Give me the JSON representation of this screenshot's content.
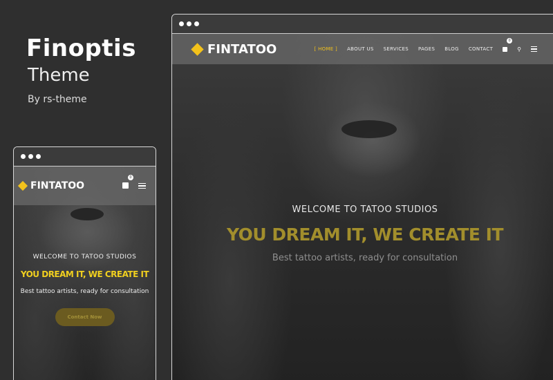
{
  "info": {
    "name": "Finoptis",
    "subtitle": "Theme",
    "author": "By rs-theme"
  },
  "brand": {
    "logo_text": "FINTATOO",
    "accent": "#f3c21b"
  },
  "desktop": {
    "nav": [
      "[ HOME ]",
      "ABOUT US",
      "SERVICES",
      "PAGES",
      "BLOG",
      "CONTACT"
    ],
    "cart_count": "0",
    "hero": {
      "welcome": "WELCOME TO TATOO STUDIOS",
      "headline": "YOU DREAM IT, WE CREATE IT",
      "tagline": "Best tattoo artists, ready for consultation"
    }
  },
  "mobile": {
    "cart_count": "0",
    "hero": {
      "welcome": "WELCOME TO TATOO STUDIOS",
      "headline": "YOU DREAM IT, WE CREATE IT",
      "tagline": "Best tattoo artists, ready for consultation",
      "cta": "Contact Now"
    }
  },
  "icons": {
    "cart": "shopping-bag-icon",
    "search": "search-icon",
    "menu": "hamburger-icon"
  }
}
